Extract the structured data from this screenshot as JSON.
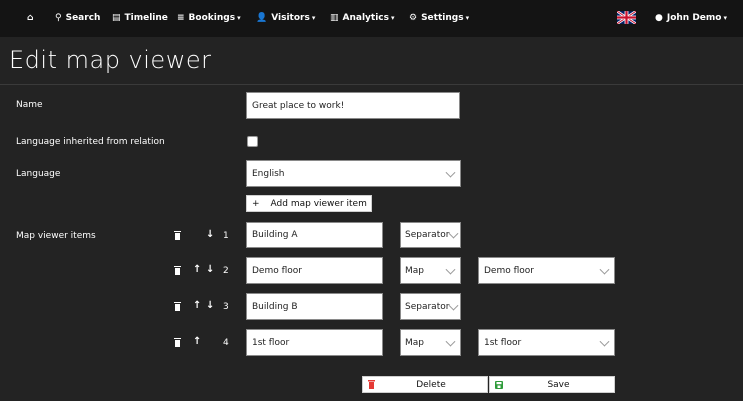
{
  "nav": {
    "search": "Search",
    "timeline": "Timeline",
    "bookings": "Bookings",
    "visitors": "Visitors",
    "analytics": "Analytics",
    "settings": "Settings",
    "user": "John Demo"
  },
  "page": {
    "title": "Edit map viewer"
  },
  "form": {
    "name_label": "Name",
    "name_value": "Great place to work!",
    "lang_inherited_label": "Language inherited from relation",
    "lang_inherited_checked": false,
    "language_label": "Language",
    "language_value": "English",
    "add_item_label": "Add map viewer item",
    "items_label": "Map viewer items"
  },
  "items": [
    {
      "index": "1",
      "name": "Building A",
      "type": "Separator",
      "map": ""
    },
    {
      "index": "2",
      "name": "Demo floor",
      "type": "Map",
      "map": "Demo floor"
    },
    {
      "index": "3",
      "name": "Building B",
      "type": "Separator",
      "map": ""
    },
    {
      "index": "4",
      "name": "1st floor",
      "type": "Map",
      "map": "1st floor"
    }
  ],
  "actions": {
    "delete": "Delete",
    "save": "Save"
  },
  "colors": {
    "delete_icon": "#e53935",
    "save_icon": "#2e9b3a",
    "nav_bg": "#141414",
    "page_bg": "#232323"
  }
}
